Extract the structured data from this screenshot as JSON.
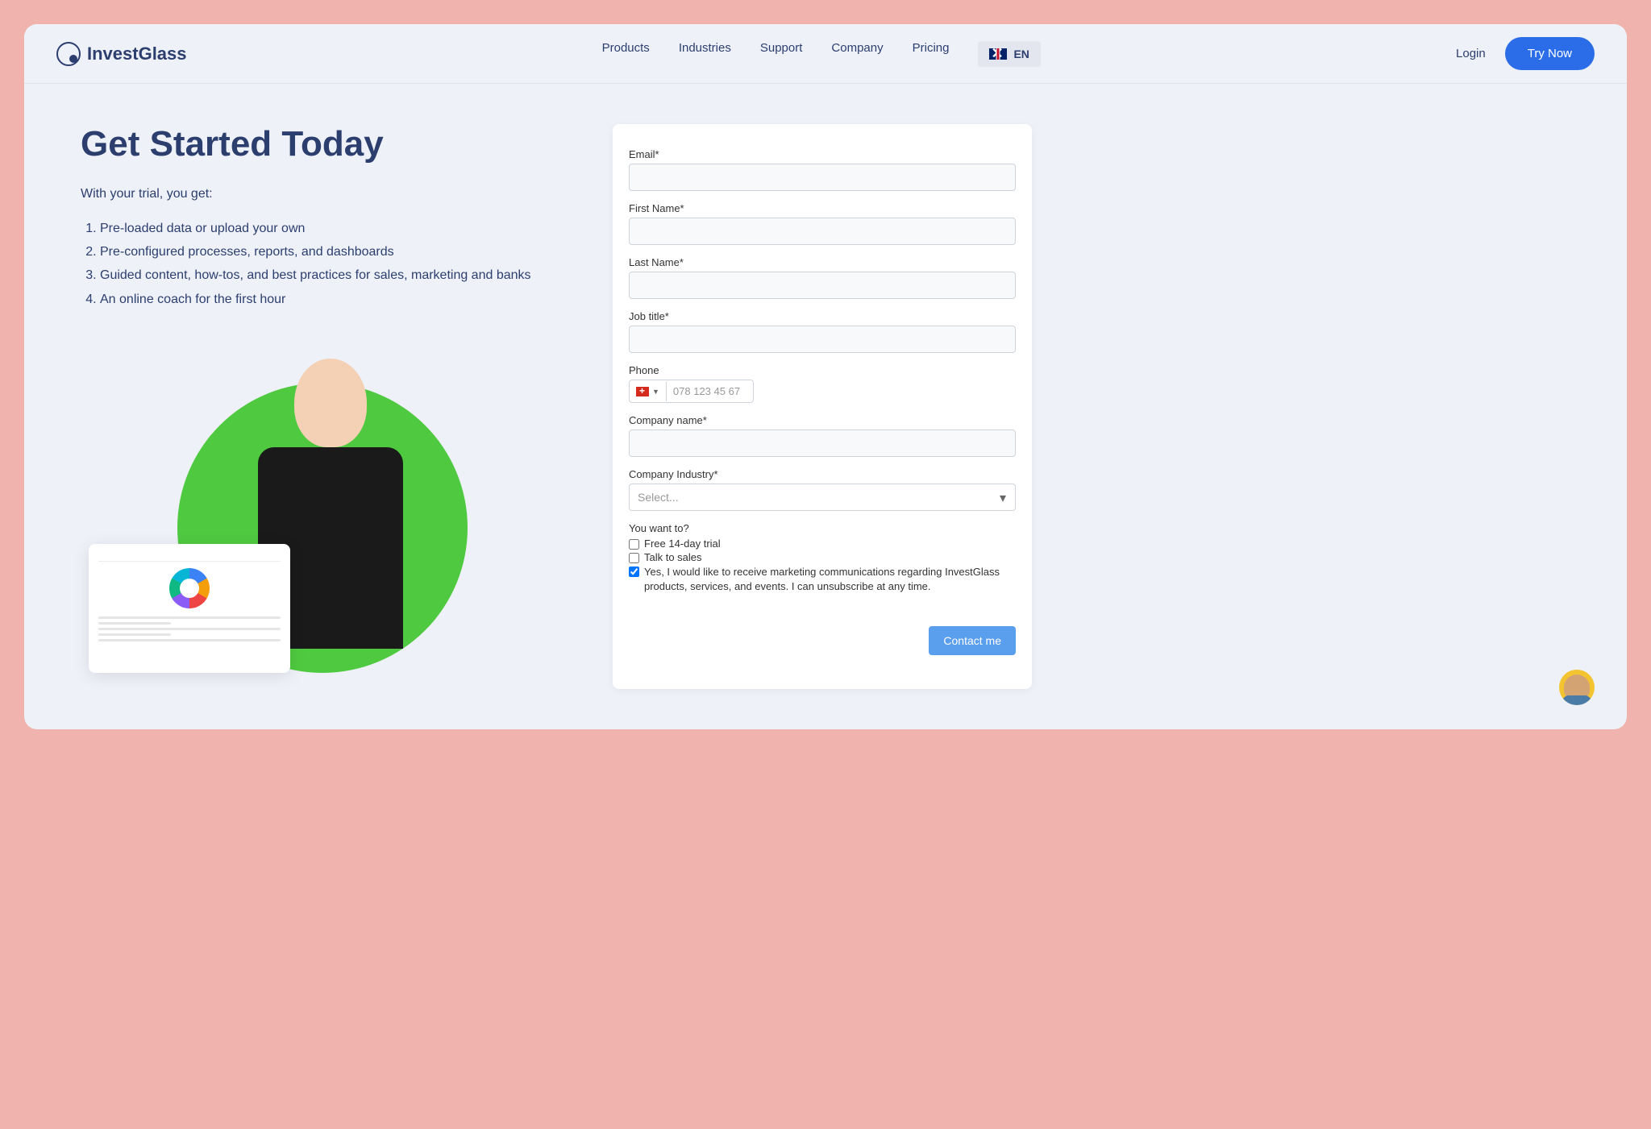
{
  "brand": "InvestGlass",
  "nav": {
    "products": "Products",
    "industries": "Industries",
    "support": "Support",
    "company": "Company",
    "pricing": "Pricing"
  },
  "lang": "EN",
  "login": "Login",
  "try_now": "Try Now",
  "hero": {
    "title": "Get Started Today",
    "subtitle": "With your trial, you get:",
    "features": [
      "Pre-loaded data or upload your own",
      "Pre-configured processes, reports, and dashboards",
      "Guided content, how-tos, and best practices for sales, marketing and banks",
      "An online coach for the first hour"
    ]
  },
  "form": {
    "email_label": "Email*",
    "firstname_label": "First Name*",
    "lastname_label": "Last Name*",
    "jobtitle_label": "Job title*",
    "phone_label": "Phone",
    "phone_placeholder": "078 123 45 67",
    "company_label": "Company name*",
    "industry_label": "Company Industry*",
    "industry_placeholder": "Select...",
    "want_label": "You want to?",
    "trial_label": "Free 14-day trial",
    "talk_label": "Talk to sales",
    "consent_label": "Yes, I would like to receive marketing communications regarding InvestGlass products, services, and events. I can unsubscribe at any time.",
    "submit": "Contact me"
  }
}
